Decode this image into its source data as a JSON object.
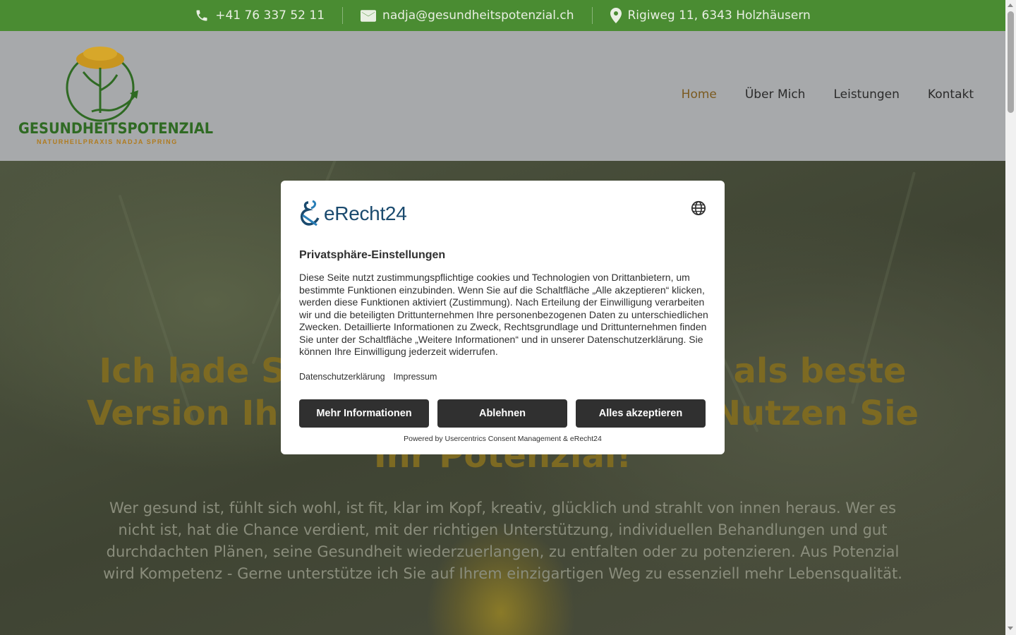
{
  "topbar": {
    "phone": "+41 76 337 52 11",
    "email": "nadja@gesundheitspotenzial.ch",
    "address": "Rigiweg 11, 6343 Holzhäusern"
  },
  "logo": {
    "title": "GESUNDHEITSPOTENZIAL",
    "subtitle": "NATURHEILPRAXIS NADJA SPRING"
  },
  "nav": {
    "items": [
      "Home",
      "Über Mich",
      "Leistungen",
      "Kontakt"
    ],
    "active": "Home"
  },
  "hero": {
    "headline": "Ich lade Sie ein, Ihre Gesundheit als beste Version Ihrer selbst zu erleben - Nutzen Sie Ihr Potenzial!",
    "text": "Wer gesund ist, fühlt sich wohl, ist fit, klar im Kopf, kreativ, glücklich und strahlt von innen heraus. Wer es nicht ist, hat die Chance verdient, mit der richtigen Unterstützung, individuellen Behandlungen und gut durchdachten Plänen, seine Gesundheit wiederzuerlangen, zu entfalten oder zu potenzieren. Aus Potenzial wird Kompetenz - Gerne unterstütze ich Sie auf Ihrem einzigartigen Weg zu essenziell mehr Lebensqualität."
  },
  "consent": {
    "brand": "eRecht24",
    "title": "Privatsphäre-Einstellungen",
    "description": "Diese Seite nutzt zustimmungspflichtige cookies und Technologien von Drittanbietern, um bestimmte Funktionen einzubinden. Wenn Sie auf die Schaltfläche „Alle akzeptieren“ klicken, werden diese Funktionen aktiviert (Zustimmung). Nach Erteilung der Einwilligung verarbeiten wir und die beteiligten Drittunternehmen Ihre personenbezogenen Daten zu unterschiedlichen Zwecken. Detaillierte Informationen zu Zweck, Rechtsgrundlage und Drittunternehmen finden Sie unter der Schaltfläche „Weitere Informationen“ und in unserer Datenschutzerklärung. Sie können Ihre Einwilligung jederzeit widerrufen.",
    "links": [
      "Datenschutzerklärung",
      "Impressum"
    ],
    "buttons": {
      "more": "Mehr Informationen",
      "decline": "Ablehnen",
      "accept": "Alles akzeptieren"
    },
    "powered": "Powered by Usercentrics Consent Management & eRecht24"
  },
  "colors": {
    "topbar": "#4a8c32",
    "brand_green": "#2f6a23",
    "accent_gold": "#b07b1e",
    "button_dark": "#303030"
  },
  "icons": [
    "phone-icon",
    "mail-icon",
    "location-pin-icon",
    "globe-icon"
  ]
}
